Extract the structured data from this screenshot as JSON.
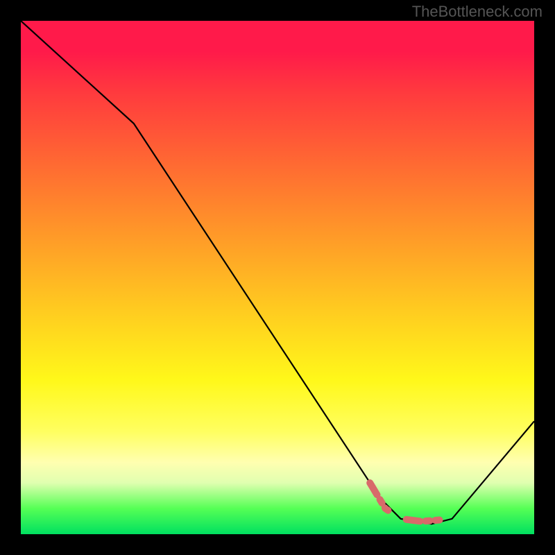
{
  "watermark": "TheBottleneck.com",
  "chart_data": {
    "type": "line",
    "title": "",
    "xlabel": "",
    "ylabel": "",
    "xlim": [
      0,
      100
    ],
    "ylim": [
      0,
      100
    ],
    "series": [
      {
        "name": "bottleneck-curve",
        "x": [
          0,
          22,
          70,
          74,
          80,
          84,
          100
        ],
        "values": [
          100,
          80,
          7,
          3,
          2,
          3,
          22
        ]
      }
    ],
    "highlight_segment": {
      "name": "optimal-range",
      "x": [
        68,
        71,
        74,
        78,
        82,
        84
      ],
      "values": [
        10,
        5,
        3,
        2.5,
        2.8,
        3.5
      ]
    },
    "background_gradient": {
      "top": "#ff1a4a",
      "mid": "#fff81a",
      "bottom": "#00e060"
    }
  }
}
